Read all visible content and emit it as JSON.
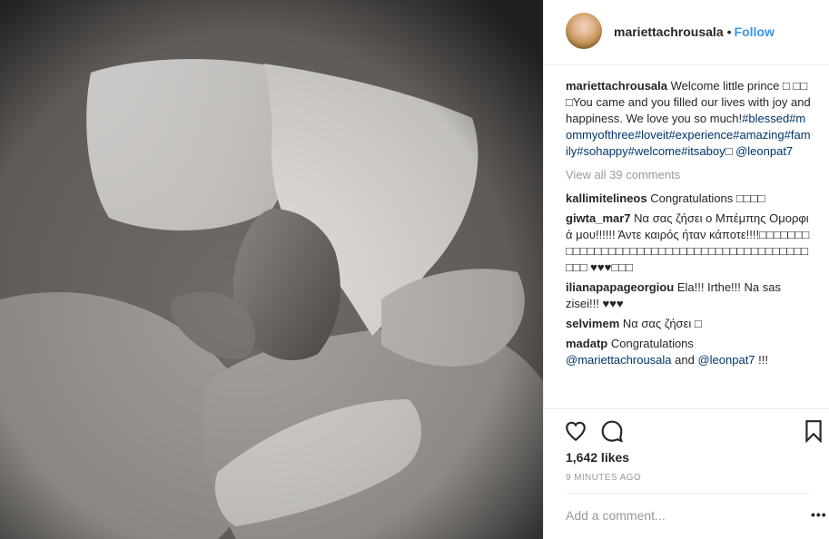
{
  "header": {
    "username": "mariettachrousala",
    "separator": "•",
    "follow_label": "Follow"
  },
  "caption": {
    "username": "mariettachrousala",
    "text": "Welcome little prince □ □□□You came and you filled our lives with joy and happiness. We love you so much!",
    "hashtags": "#blessed#mommyofthree#loveit#experience#amazing#family#sohappy#welcome#itsaboy",
    "tail": "□ ",
    "mention": "@leonpat7"
  },
  "view_all_comments": "View all 39 comments",
  "comments": [
    {
      "username": "kallimitelineos",
      "text": "Congratulations □□□□"
    },
    {
      "username": "giwta_mar7",
      "text": "Να σας ζήσει ο Μπέμπης Ομορφιά μου!!!!!! Άντε καιρός ήταν κάποτε!!!!□□□□□□□□□□□□□□□□□□□□□□□□□□□□□□□□□□□□□□□□□□□□ ♥♥♥□□□"
    },
    {
      "username": "ilianapapageorgiou",
      "text": "Ela!!! Irthe!!! Na sas zisei!!! ♥♥♥"
    },
    {
      "username": "selvimem",
      "text": "Να σας ζήσει □"
    },
    {
      "username": "madatp",
      "text": "Congratulations",
      "mention1": "@mariettachrousala",
      "and_text": " and ",
      "mention2": "@leonpat7",
      "end_text": " !!!"
    }
  ],
  "actions": {
    "likes": "1,642 likes",
    "time_ago": "9 MINUTES AGO",
    "comment_placeholder": "Add a comment...",
    "more_label": "•••"
  },
  "icons": [
    "heart-icon",
    "comment-icon",
    "bookmark-icon"
  ]
}
